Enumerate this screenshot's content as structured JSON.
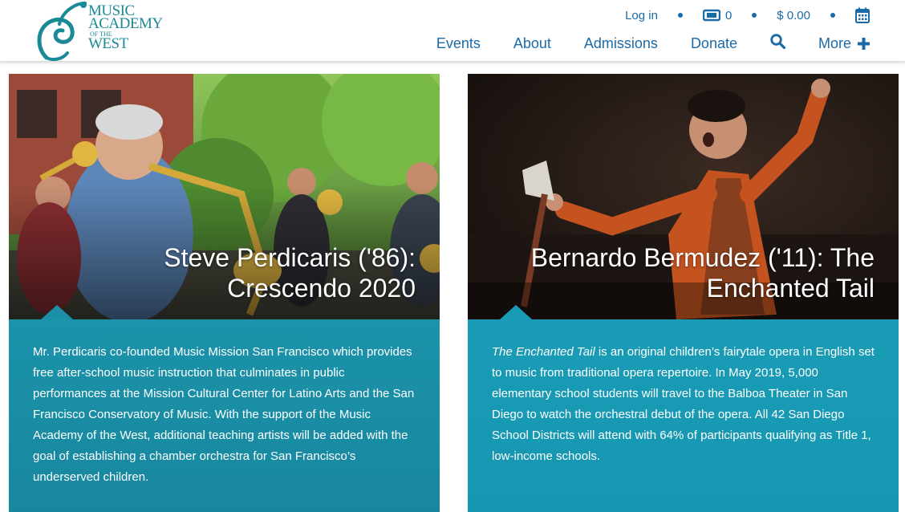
{
  "brand": {
    "logo_lines": [
      "MUSIC",
      "ACADEMY",
      "OF THE",
      "WEST"
    ],
    "color": "#1b8a96"
  },
  "util": {
    "login": "Log in",
    "tickets": "0",
    "cart": "$ 0.00",
    "calendar_icon": "calendar-icon",
    "ticket_icon": "ticket-icon"
  },
  "nav": {
    "items": [
      "Events",
      "About",
      "Admissions",
      "Donate"
    ],
    "more": "More",
    "search_icon": "search-icon",
    "plus_icon": "plus-icon"
  },
  "cards": [
    {
      "title": "Steve Perdicaris ('86): Crescendo 2020",
      "body": "Mr. Perdicaris co-founded Music Mission San Francisco which provides free after-school music instruction that culminates in public performances at the Mission Cultural Center for Latino Arts and the San Francisco Conservatory of Music. With the support of the Music Academy of the West, additional teaching artists will be added with the goal of establishing a chamber orchestra for San Francisco’s underserved children."
    },
    {
      "title": "Bernardo Bermudez ('11): The Enchanted Tail",
      "body_em": "The Enchanted Tail",
      "body": " is an original children’s fairytale opera in English set to music from traditional opera repertoire. In May 2019, 5,000 elementary school students will travel to the Balboa Theater in San Diego to watch the orchestral debut of the opera. All 42 San Diego School Districts will attend with 64% of participants qualifying as Title 1, low-income schools."
    }
  ],
  "colors": {
    "link": "#1b6aa8",
    "panel": "#1b93aa"
  }
}
